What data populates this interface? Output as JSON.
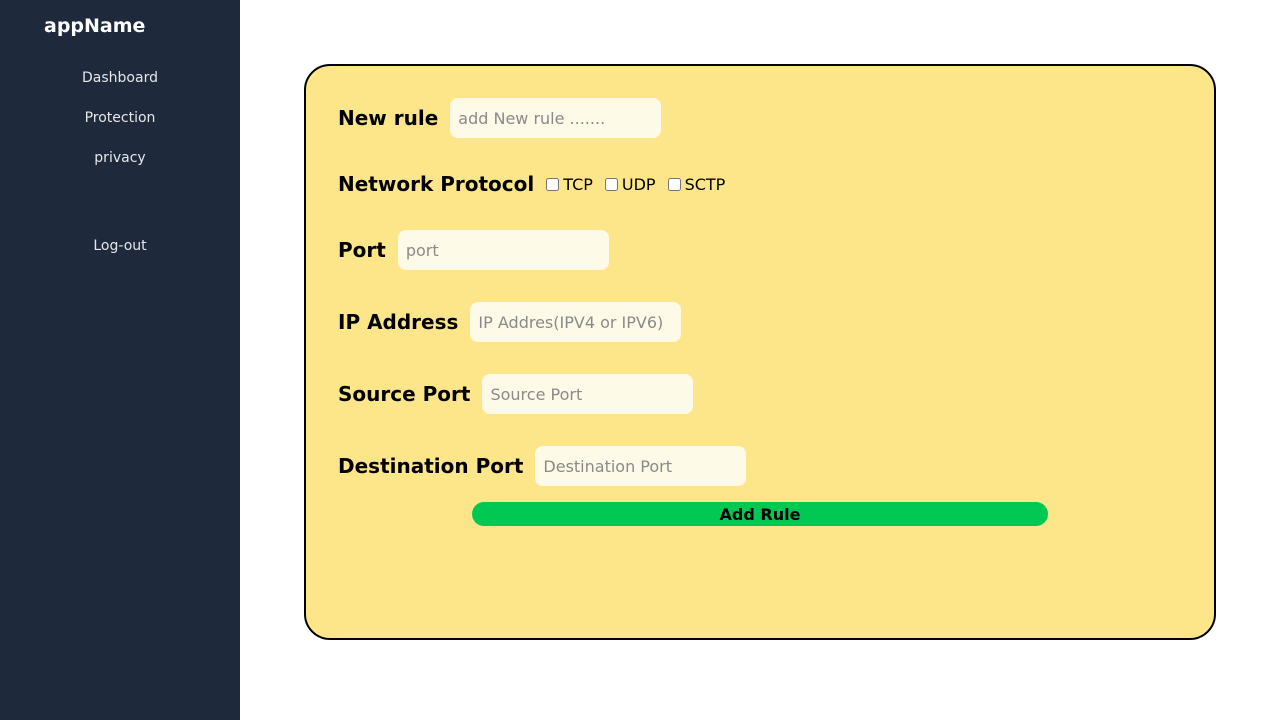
{
  "sidebar": {
    "app_name": "appName",
    "items": [
      {
        "label": "Dashboard"
      },
      {
        "label": "Protection"
      },
      {
        "label": "privacy"
      }
    ],
    "logout_label": "Log-out"
  },
  "form": {
    "new_rule": {
      "label": "New rule",
      "placeholder": "add New rule .......",
      "value": ""
    },
    "protocol": {
      "label": "Network Protocol",
      "options": [
        {
          "label": "TCP",
          "checked": false
        },
        {
          "label": "UDP",
          "checked": false
        },
        {
          "label": "SCTP",
          "checked": false
        }
      ]
    },
    "port": {
      "label": "Port",
      "placeholder": "port",
      "value": ""
    },
    "ip_address": {
      "label": "IP Address",
      "placeholder": "IP Addres(IPV4 or IPV6)",
      "value": ""
    },
    "source_port": {
      "label": "Source Port",
      "placeholder": "Source Port",
      "value": ""
    },
    "destination_port": {
      "label": "Destination Port",
      "placeholder": "Destination Port",
      "value": ""
    },
    "submit_label": "Add Rule"
  },
  "colors": {
    "sidebar_bg": "#1e293b",
    "card_bg": "#fde68a",
    "button_bg": "#00c853",
    "input_bg": "#fefae8"
  }
}
